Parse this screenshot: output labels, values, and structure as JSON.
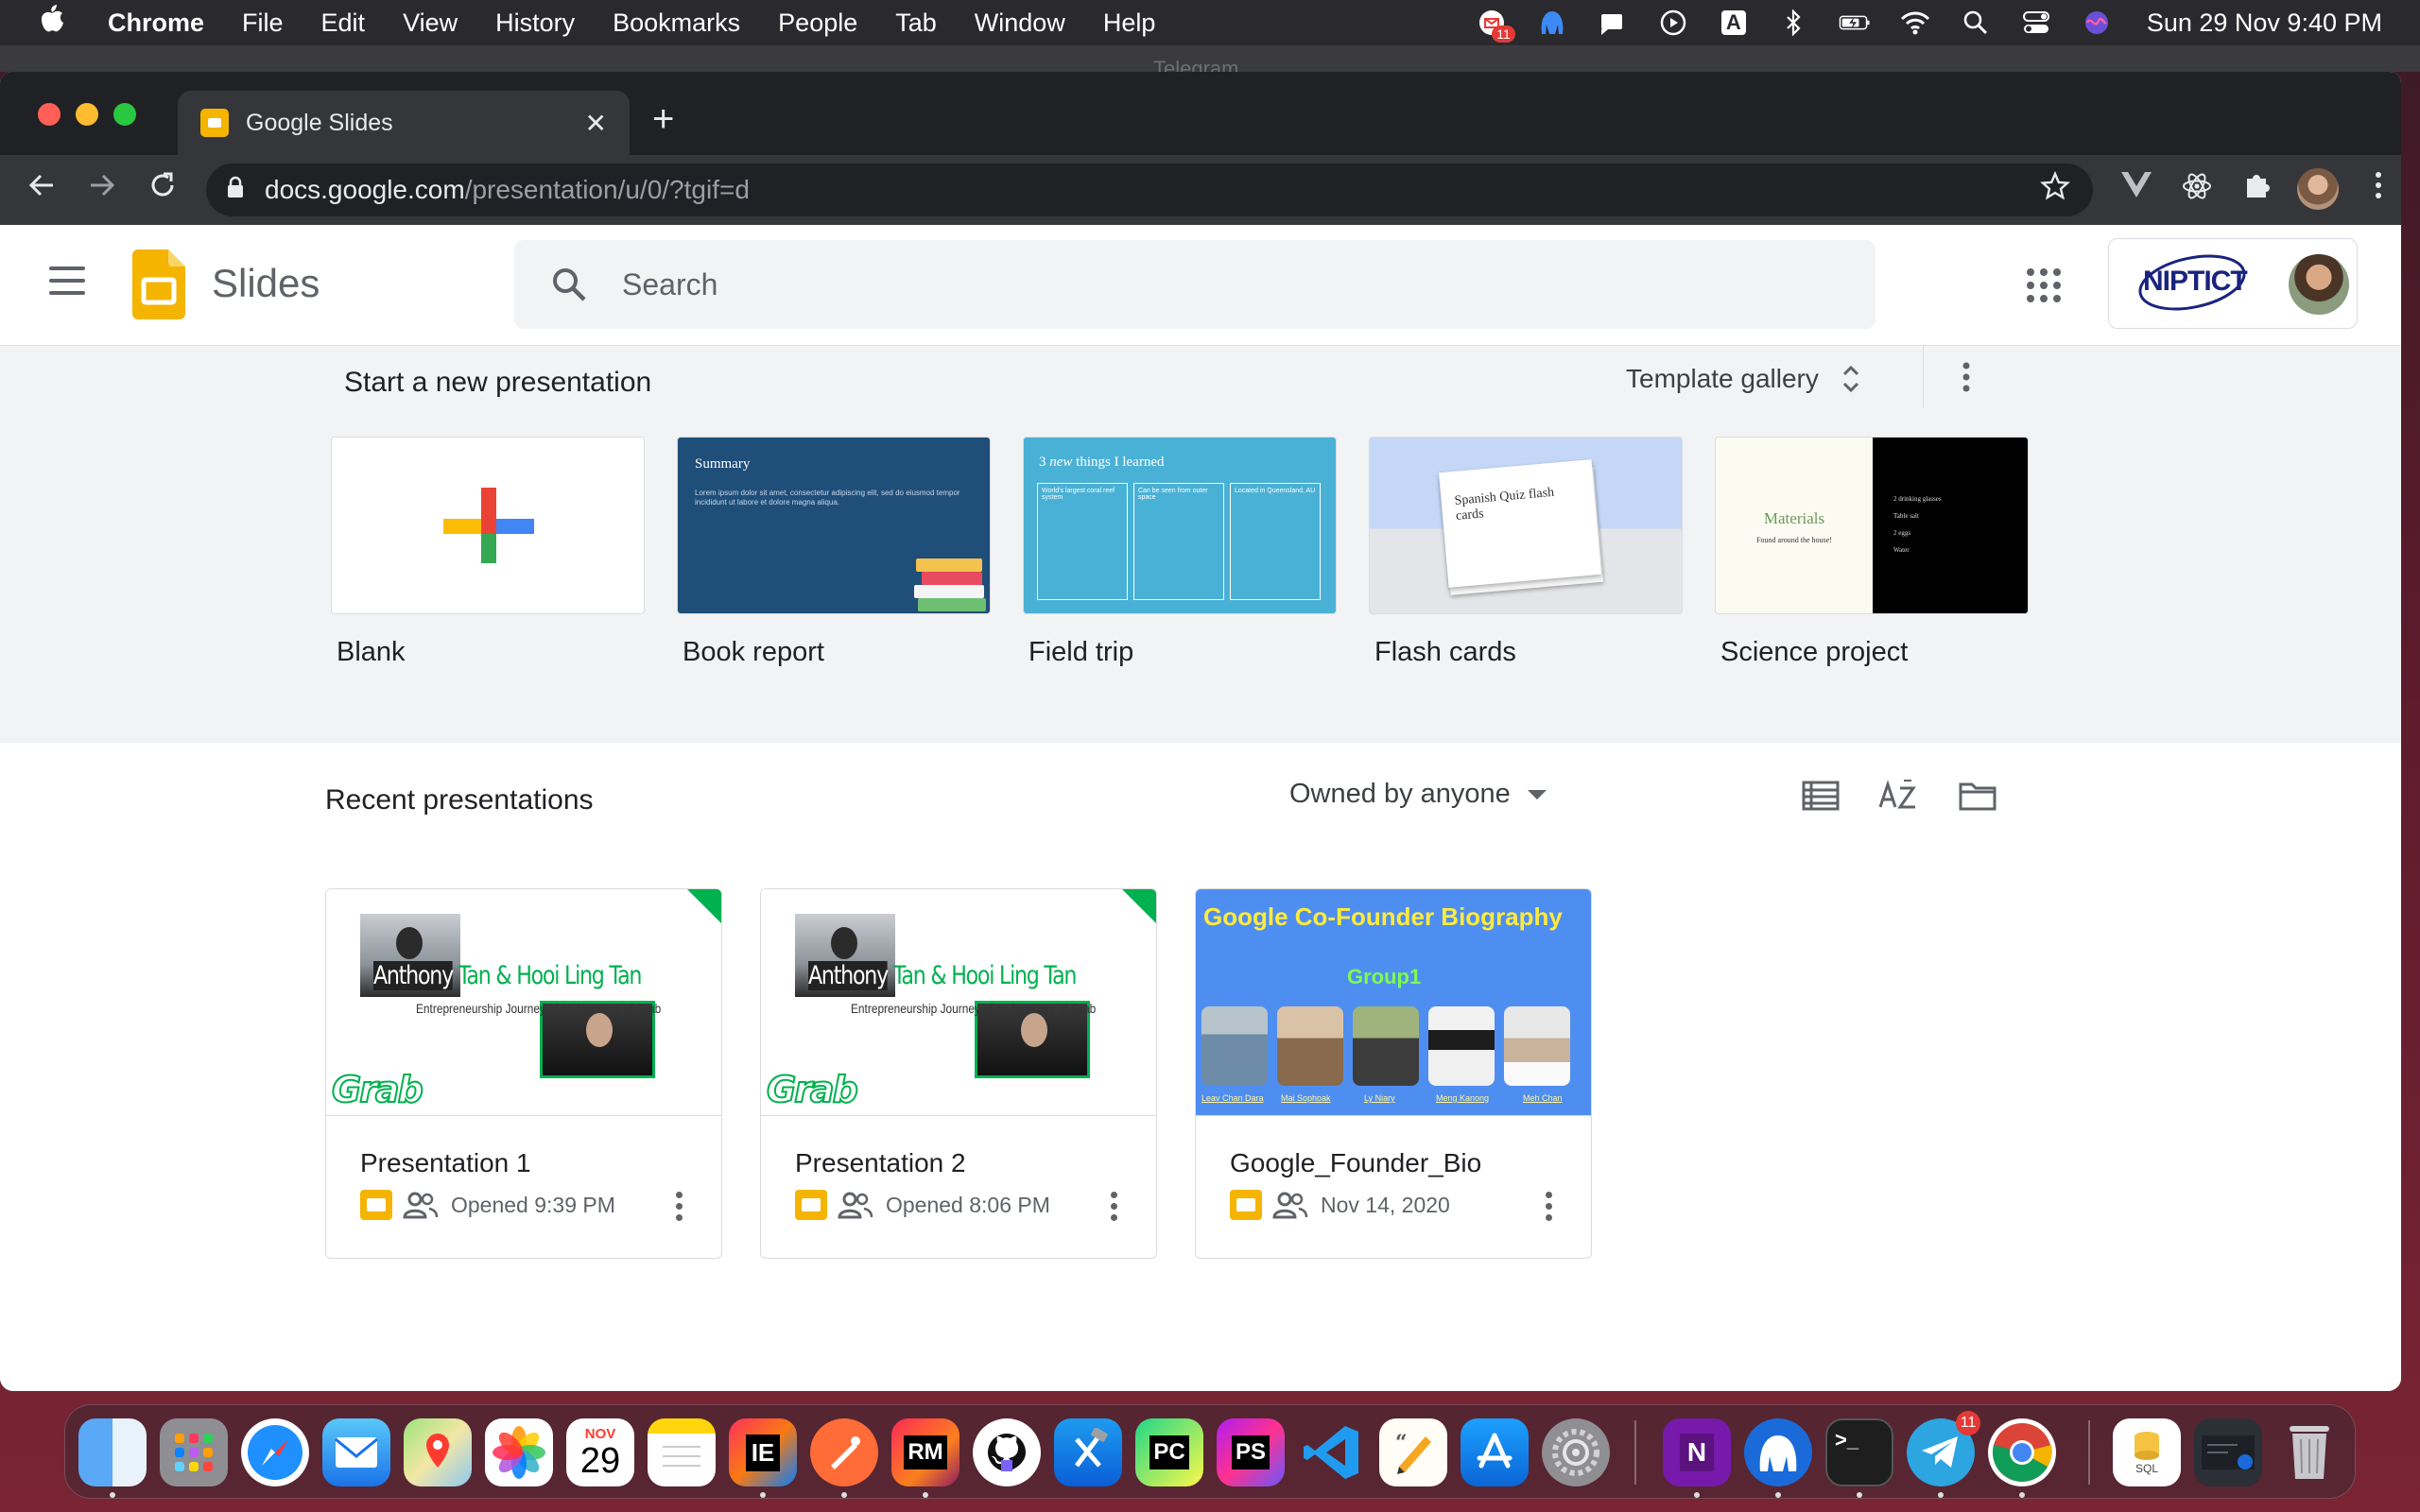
{
  "menubar": {
    "apple": "",
    "items": [
      "Chrome",
      "File",
      "Edit",
      "View",
      "History",
      "Bookmarks",
      "People",
      "Tab",
      "Window",
      "Help"
    ],
    "tray_icons": [
      "mail-badge-icon",
      "app-icon",
      "notification-icon",
      "play-icon",
      "keyboard-a-icon",
      "bluetooth-icon",
      "battery-icon",
      "wifi-icon",
      "search-icon",
      "control-center-icon",
      "siri-icon"
    ],
    "tray_badge": "11",
    "keyboard_label": "A",
    "clock": "Sun 29 Nov  9:40 PM"
  },
  "background_window": {
    "title": "Telegram"
  },
  "browser": {
    "tab_title": "Google Slides",
    "new_tab": "+",
    "tab_close": "✕",
    "url_host": "docs.google.com",
    "url_path": "/presentation/u/0/?tgif=d"
  },
  "app": {
    "name": "Slides",
    "search_placeholder": "Search",
    "org_logo_text": "NIPTICT"
  },
  "new_presentation": {
    "heading": "Start a new presentation",
    "template_gallery": "Template gallery",
    "templates": [
      {
        "label": "Blank"
      },
      {
        "label": "Book report",
        "thumb_title": "Summary",
        "thumb_text": "Lorem ipsum dolor sit amet, consectetur adipiscing elit, sed do eiusmod tempor incididunt ut labore et dolore magna aliqua."
      },
      {
        "label": "Field trip",
        "thumb_title_prefix": "3 ",
        "thumb_title_em": "new",
        "thumb_title_suffix": " things I learned",
        "thumb_cols": [
          "World's largest coral reef system",
          "Can be seen from outer space",
          "Located in Queensland, AU"
        ]
      },
      {
        "label": "Flash cards",
        "thumb_card": "Spanish Quiz flash cards"
      },
      {
        "label": "Science project",
        "thumb_title": "Materials",
        "thumb_subtitle": "Found around the house!",
        "thumb_list": [
          "2 drinking glasses",
          "Table salt",
          "2 eggs",
          "Water"
        ]
      }
    ]
  },
  "recent": {
    "heading": "Recent presentations",
    "owner_filter": "Owned by anyone",
    "documents": [
      {
        "name": "Presentation 1",
        "opened": "Opened 9:39 PM",
        "preview_title_first": "Anthony",
        "preview_title_rest": " Tan & Hooi Ling Tan",
        "preview_subtitle": "Entrepreneurship Journey of co-founders of Grab",
        "preview_logo": "Grab"
      },
      {
        "name": "Presentation 2",
        "opened": "Opened 8:06 PM",
        "preview_title_first": "Anthony",
        "preview_title_rest": " Tan & Hooi Ling Tan",
        "preview_subtitle": "Entrepreneurship Journey of co-founders of Grab",
        "preview_logo": "Grab"
      },
      {
        "name": "Google_Founder_Bio",
        "opened": "Nov 14, 2020",
        "preview_title": "Google Co-Founder Biography",
        "preview_group": "Group1",
        "preview_names": [
          "Leav Chan Dara",
          "Mai Sophoak",
          "Ly Niary",
          "Meng Kanong",
          "Meh Chan"
        ]
      }
    ]
  },
  "dock": {
    "calendar_month": "NOV",
    "calendar_day": "29",
    "ie_label": "IE",
    "rm_label": "RM",
    "pc_label": "PC",
    "ps_label": "PS",
    "onenote_label": "N",
    "terminal_label": ">_",
    "telegram_badge": "11",
    "sql_label": "SQL"
  },
  "colors": {
    "slides_yellow": "#f4b400",
    "grab_green": "#00b14f",
    "book_report_blue": "#1f4e79",
    "field_trip_teal": "#4ab1d6",
    "gf_blue": "#4f8ef1"
  }
}
